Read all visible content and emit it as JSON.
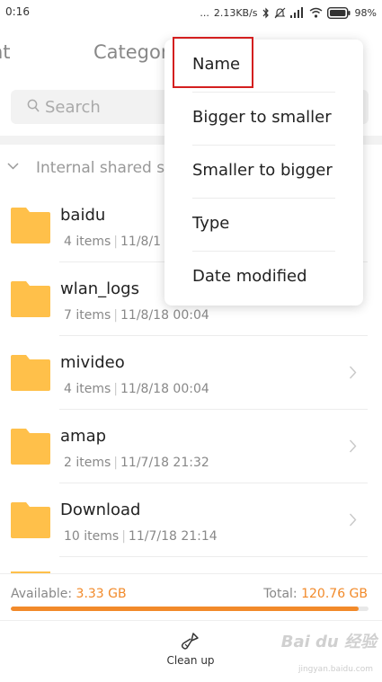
{
  "status_bar": {
    "time": "0:16",
    "dots": "...",
    "speed": "2.13KB/s",
    "battery": "98%",
    "icons": [
      "bluetooth-icon",
      "mute-icon",
      "signal-icon",
      "wifi-icon",
      "battery-icon"
    ]
  },
  "tabs": [
    {
      "label": "nt"
    },
    {
      "label": "Categor"
    }
  ],
  "search": {
    "placeholder": "Search"
  },
  "storage": {
    "title": "Internal shared st"
  },
  "files": [
    {
      "name": "baidu",
      "items": "4 items",
      "date": "11/8/1"
    },
    {
      "name": "wlan_logs",
      "items": "7 items",
      "date": "11/8/18 00:04"
    },
    {
      "name": "mivideo",
      "items": "4 items",
      "date": "11/8/18 00:04"
    },
    {
      "name": "amap",
      "items": "2 items",
      "date": "11/7/18 21:32"
    },
    {
      "name": "Download",
      "items": "10 items",
      "date": "11/7/18 21:14"
    }
  ],
  "storage_summary": {
    "available_label": "Available:",
    "available_value": "3.33 GB",
    "total_label": "Total:",
    "total_value": "120.76 GB",
    "used_fraction": 0.9724
  },
  "toolbar": {
    "clean_label": "Clean up"
  },
  "sort_menu": {
    "items": [
      {
        "label": "Name"
      },
      {
        "label": "Bigger to smaller"
      },
      {
        "label": "Smaller to bigger"
      },
      {
        "label": "Type"
      },
      {
        "label": "Date modified"
      }
    ]
  },
  "watermark": {
    "logo": "Bai du 经验",
    "url": "jingyan.baidu.com"
  },
  "colors": {
    "accent": "#f28a2a",
    "folder": "#ffc04a",
    "highlight": "#d41f1f"
  }
}
